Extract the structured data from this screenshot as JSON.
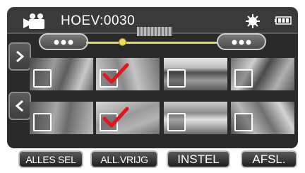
{
  "header": {
    "mode_label": "HOEV:0030",
    "mode_icon": "video-camera-icon",
    "lighting_icon": "sun-icon",
    "battery_icon": "battery-full-icon"
  },
  "colors": {
    "panel": "#2a2a2a",
    "timeline": "#e8d36a",
    "checkmark": "#e8141c"
  },
  "thumbnails": [
    {
      "checked": false
    },
    {
      "checked": true
    },
    {
      "checked": false
    },
    {
      "checked": false
    },
    {
      "checked": false
    },
    {
      "checked": true
    },
    {
      "checked": false
    },
    {
      "checked": false
    }
  ],
  "buttons": {
    "select_all": "ALLES SEL",
    "release_all": "ALL.VRIJG",
    "set": "INSTEL",
    "quit": "AFSL."
  }
}
